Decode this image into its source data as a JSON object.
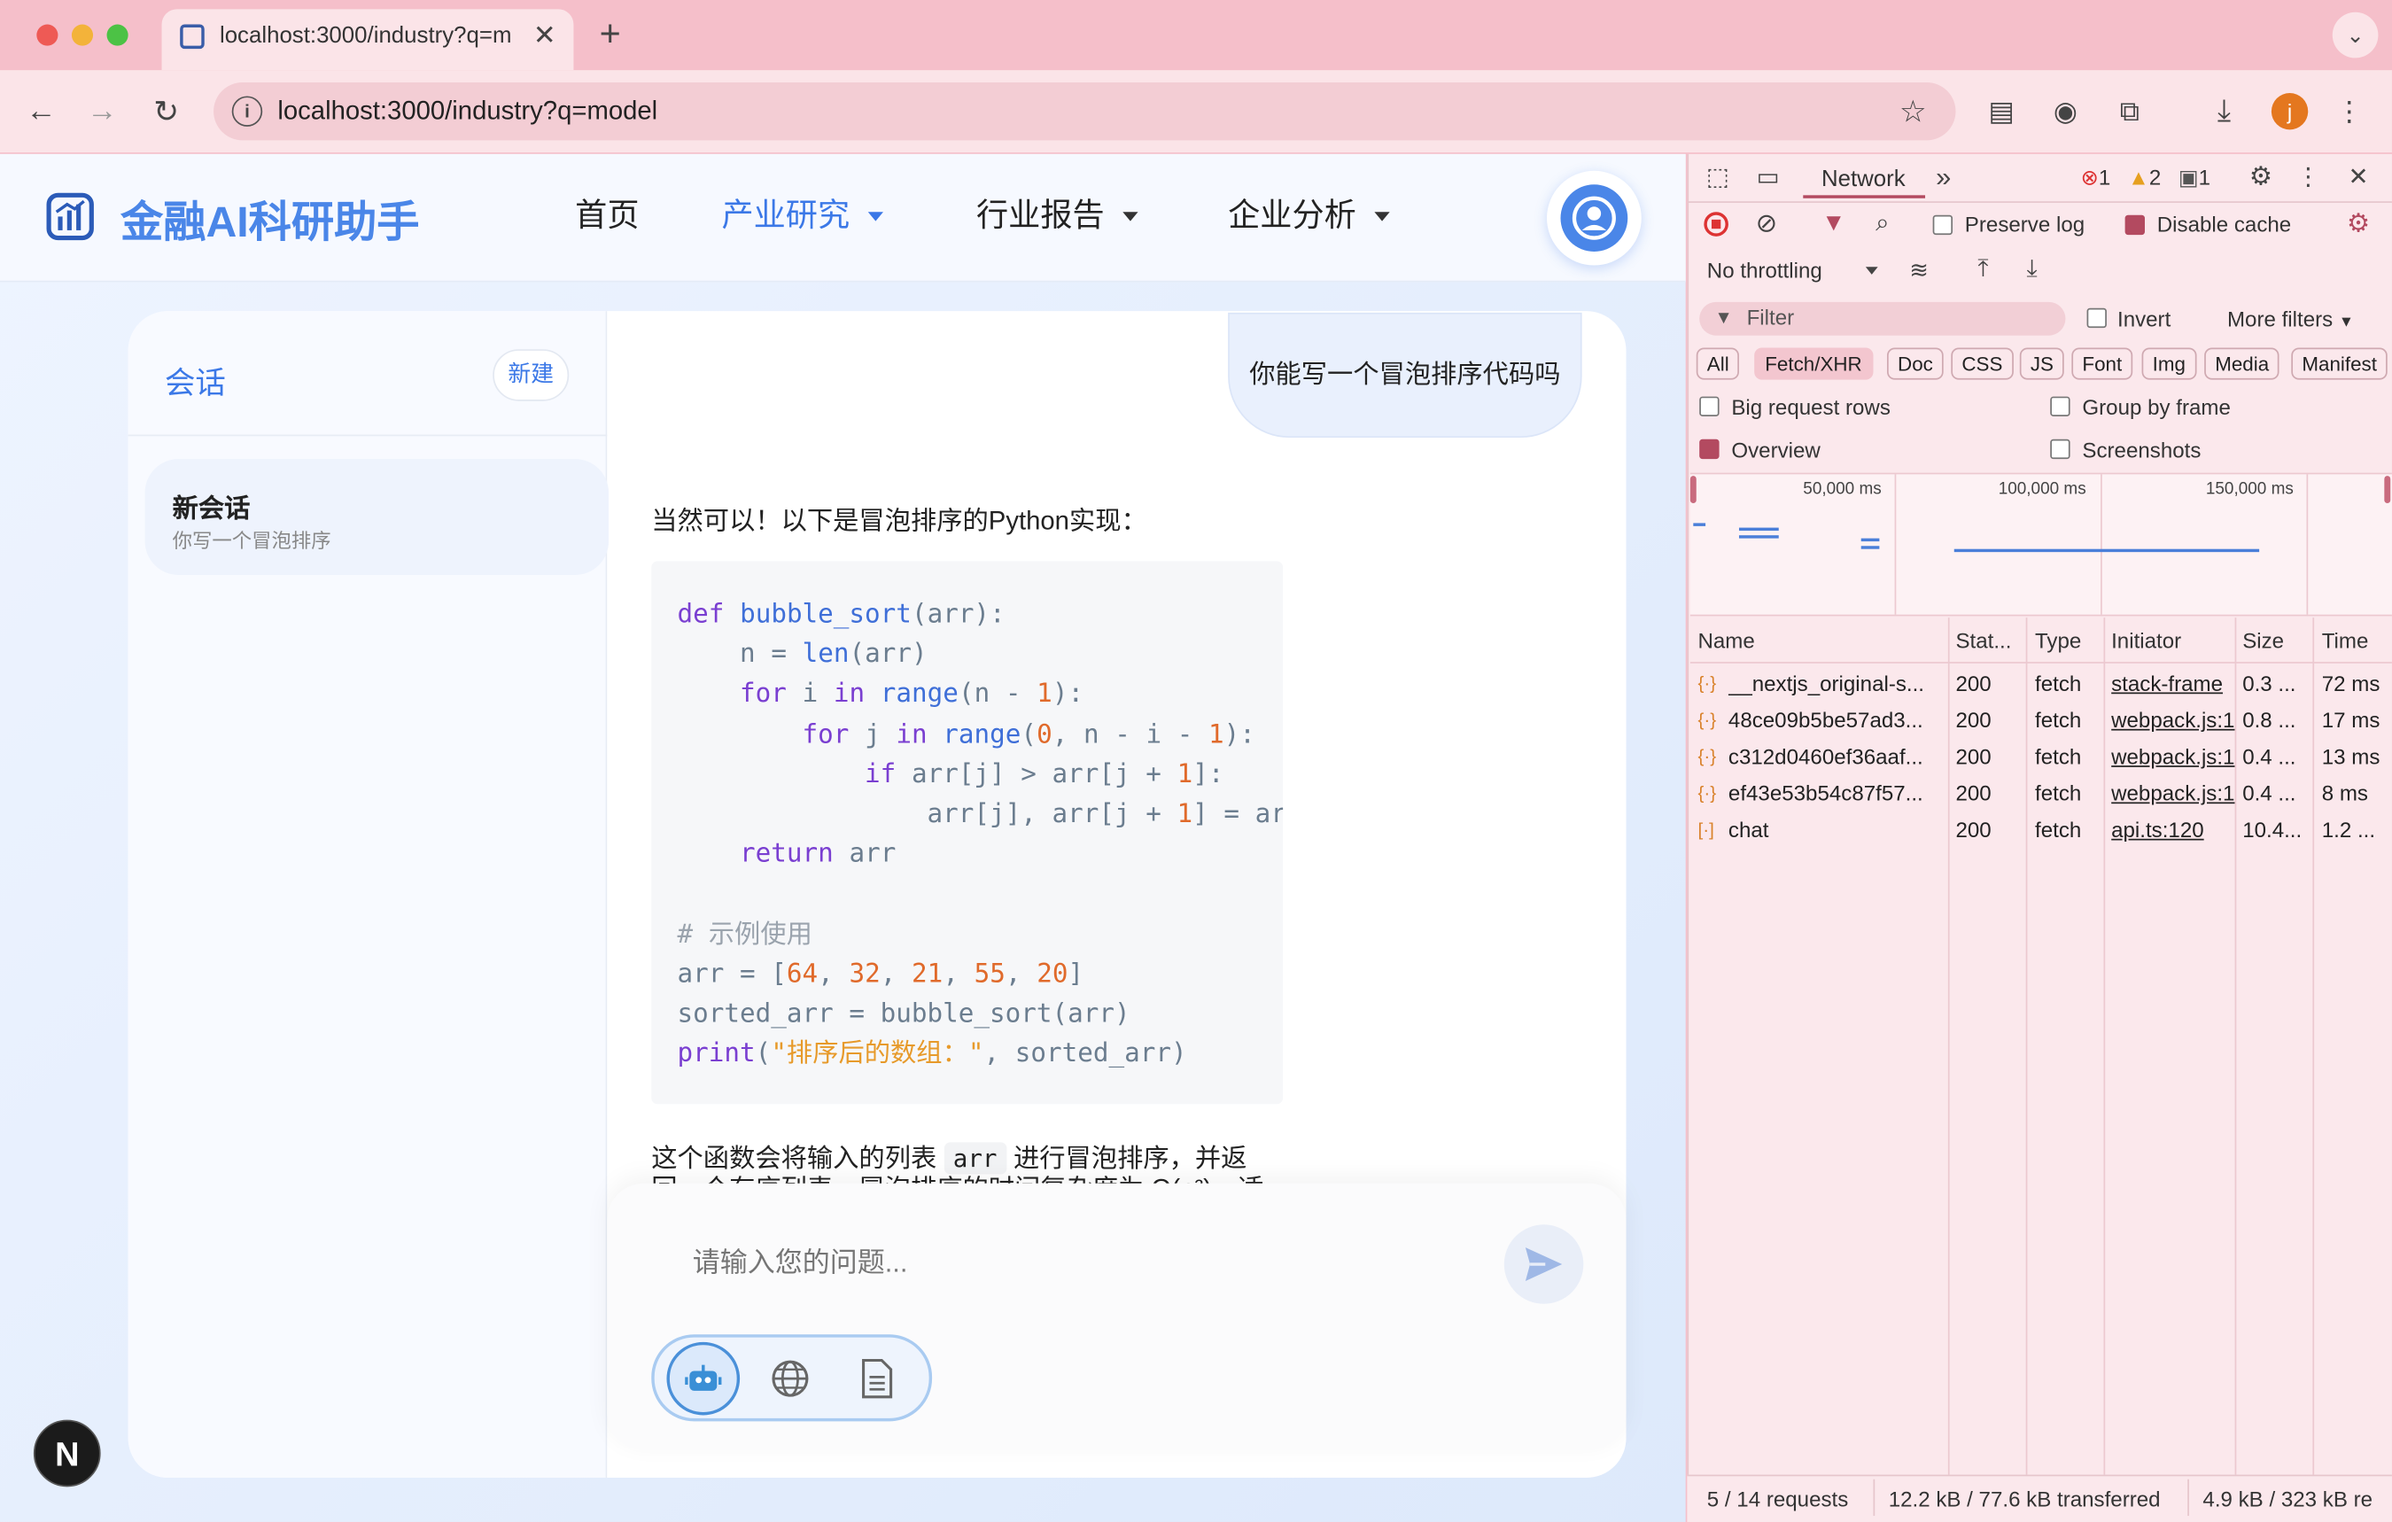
{
  "browser": {
    "tab_title": "localhost:3000/industry?q=m",
    "url": "localhost:3000/industry?q=model",
    "profile_initial": "j"
  },
  "app": {
    "brand": "金融AI科研助手",
    "nav": [
      {
        "label": "首页"
      },
      {
        "label": "产业研究"
      },
      {
        "label": "行业报告"
      },
      {
        "label": "企业分析"
      }
    ],
    "sidebar": {
      "title": "会话",
      "new_button": "新建",
      "sessions": [
        {
          "title": "新会话",
          "preview": "你写一个冒泡排序"
        }
      ]
    },
    "chat": {
      "user_message": "你能写一个冒泡排序代码吗",
      "assistant_intro": "当然可以！以下是冒泡排序的Python实现：",
      "assistant_outro_a": "这个函数会将输入的列表",
      "assistant_outro_code": "arr",
      "assistant_outro_b": "进行冒泡排序，并返",
      "assistant_outro_line2": "回一个有序列表。冒泡排序的时间复杂度为 O(n²)，适"
    },
    "input": {
      "placeholder": "请输入您的问题..."
    },
    "next_badge": "N"
  },
  "devtools": {
    "panel_tab": "Network",
    "errors": "1",
    "warnings": "2",
    "messages": "1",
    "preserve_log": "Preserve log",
    "disable_cache": "Disable cache",
    "throttling": "No throttling",
    "filter_placeholder": "Filter",
    "invert": "Invert",
    "more_filters": "More filters",
    "type_chips": [
      "All",
      "Fetch/XHR",
      "Doc",
      "CSS",
      "JS",
      "Font",
      "Img",
      "Media",
      "Manifest"
    ],
    "active_chip": "Fetch/XHR",
    "big_rows": "Big request rows",
    "group_by_frame": "Group by frame",
    "overview": "Overview",
    "screenshots": "Screenshots",
    "timeline_ticks": [
      "50,000 ms",
      "100,000 ms",
      "150,000 ms"
    ],
    "columns": [
      "Name",
      "Stat...",
      "Type",
      "Initiator",
      "Size",
      "Time"
    ],
    "rows": [
      {
        "name": "__nextjs_original-s...",
        "status": "200",
        "type": "fetch",
        "initiator": "stack-frame",
        "size": "0.3 ...",
        "time": "72 ms"
      },
      {
        "name": "48ce09b5be57ad3...",
        "status": "200",
        "type": "fetch",
        "initiator": "webpack.js:1",
        "size": "0.8 ...",
        "time": "17 ms"
      },
      {
        "name": "c312d0460ef36aaf...",
        "status": "200",
        "type": "fetch",
        "initiator": "webpack.js:1",
        "size": "0.4 ...",
        "time": "13 ms"
      },
      {
        "name": "ef43e53b54c87f57...",
        "status": "200",
        "type": "fetch",
        "initiator": "webpack.js:1",
        "size": "0.4 ...",
        "time": "8 ms"
      },
      {
        "name": "chat",
        "status": "200",
        "type": "fetch",
        "initiator": "api.ts:120",
        "size": "10.4...",
        "time": "1.2 ..."
      }
    ],
    "footer": {
      "requests": "5 / 14 requests",
      "transferred": "12.2 kB / 77.6 kB transferred",
      "resources": "4.9 kB / 323 kB re"
    }
  },
  "colors": {
    "accent": "#3b78e7",
    "brand_gradient": "#4a86e8",
    "chrome": "#f5bfca"
  }
}
